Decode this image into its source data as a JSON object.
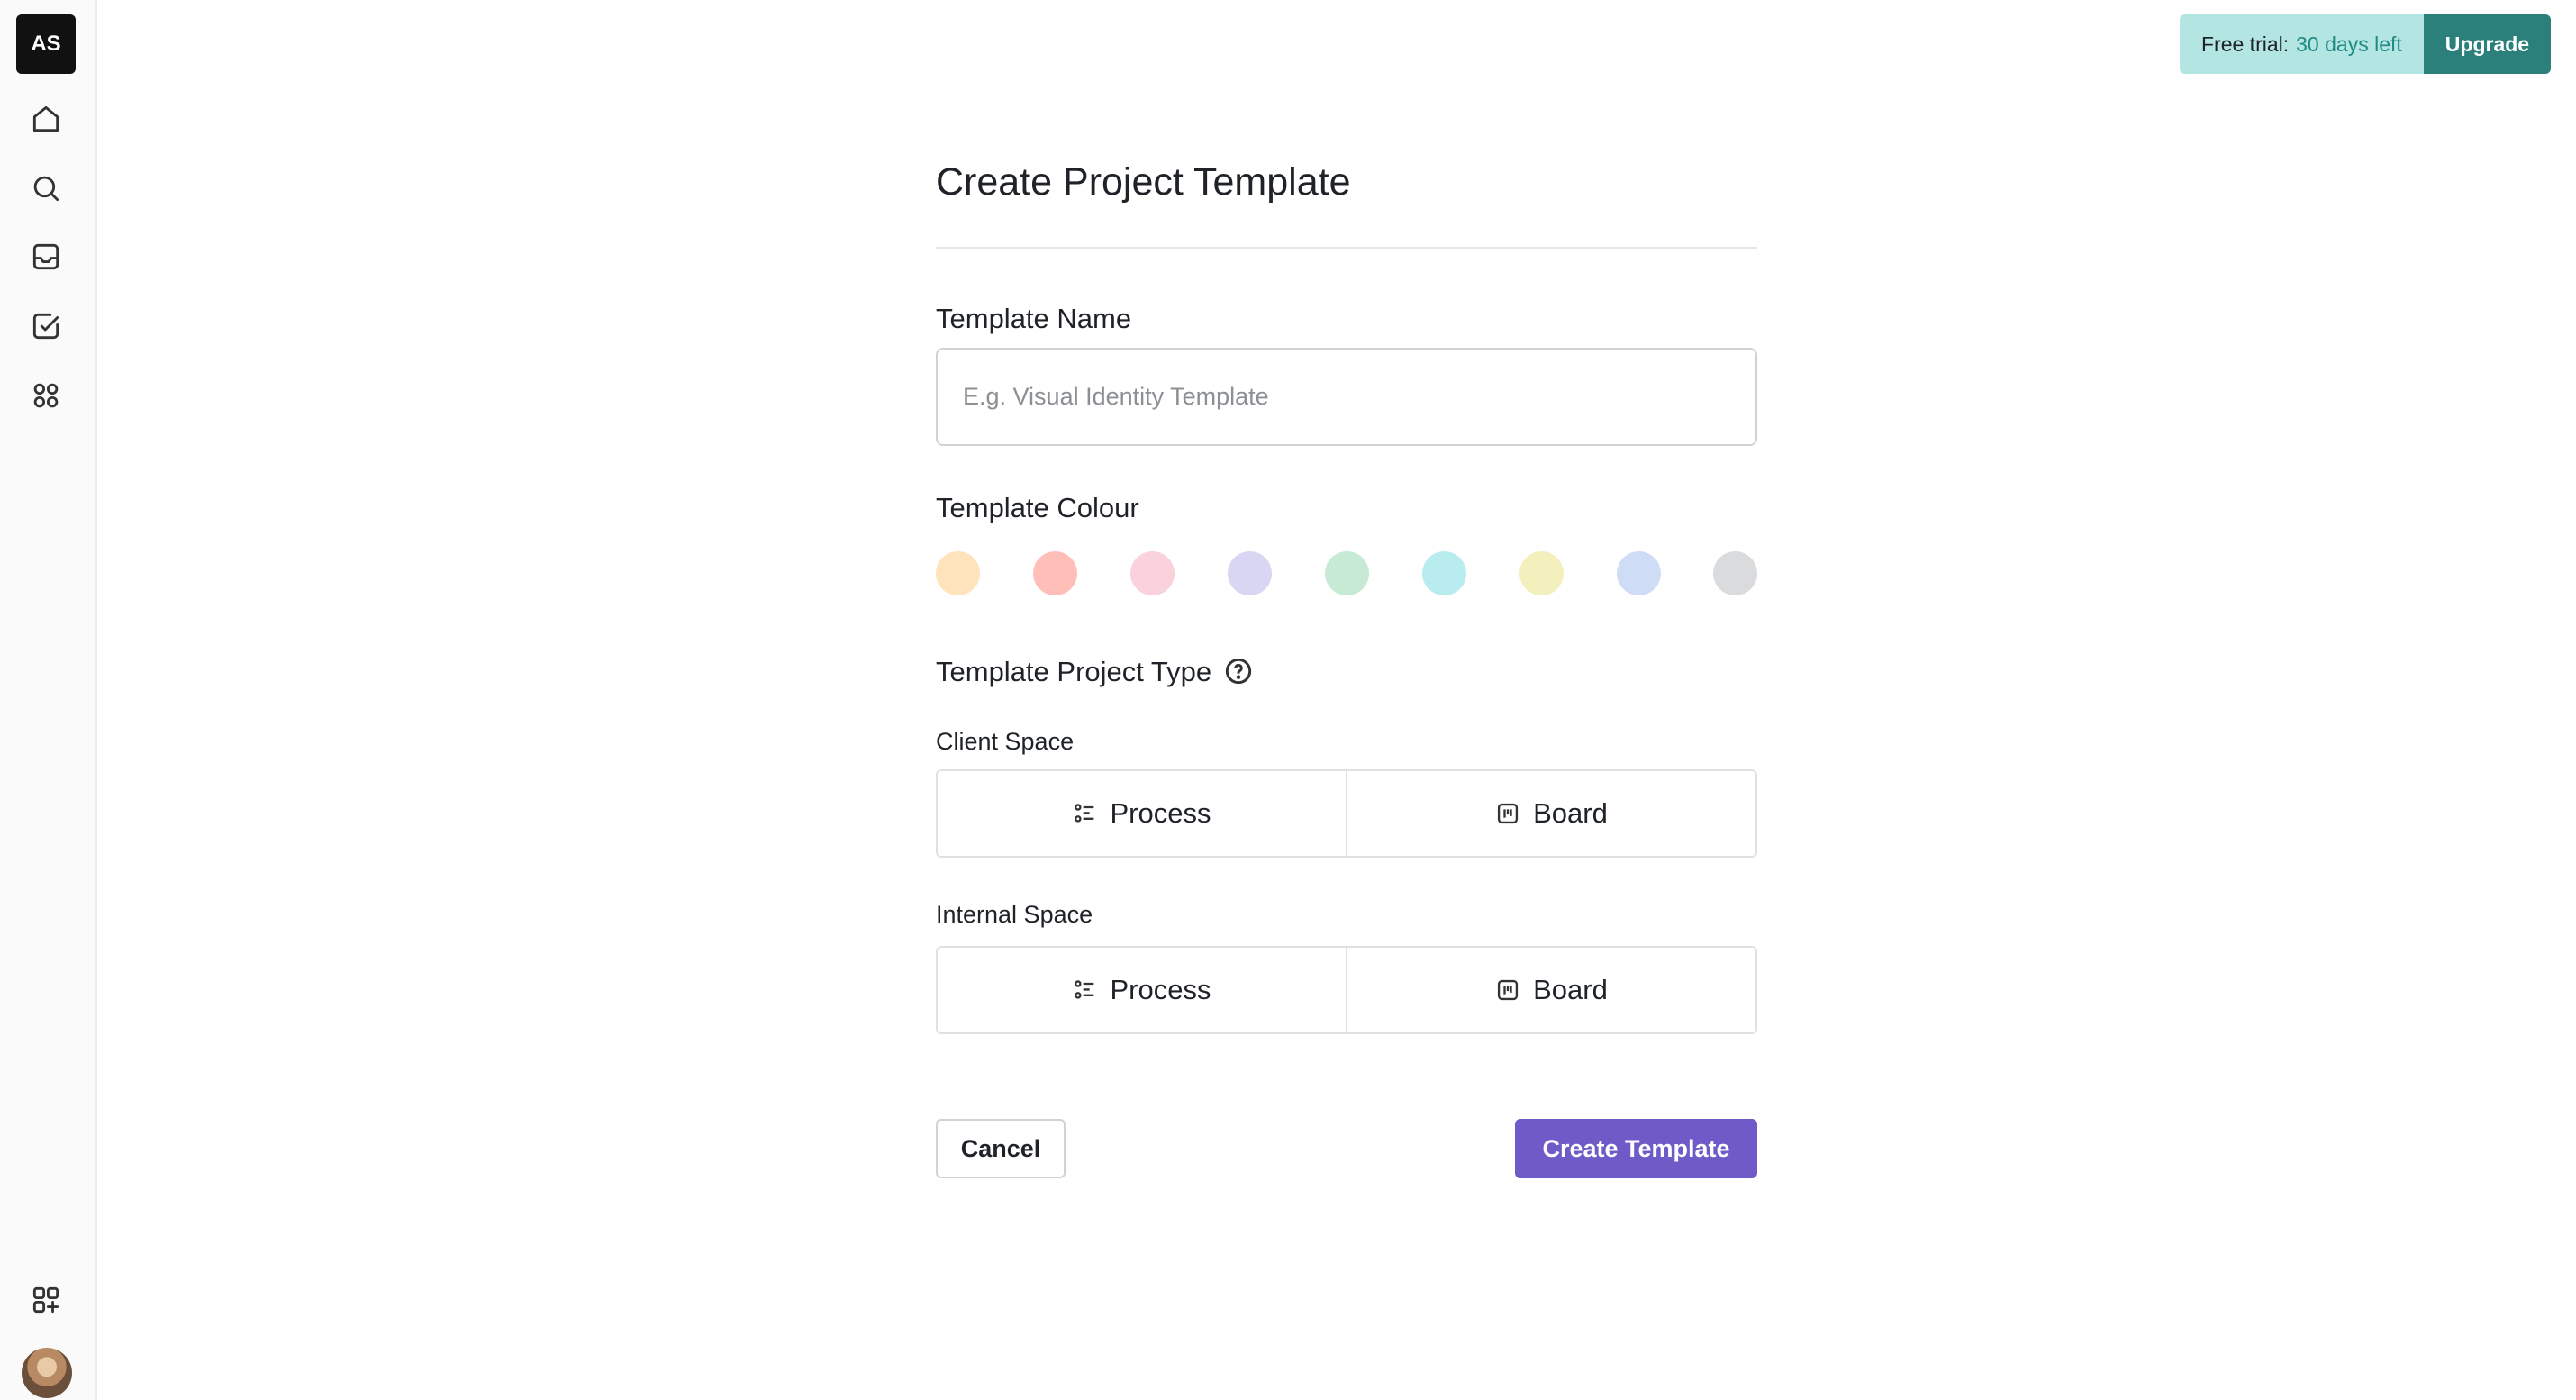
{
  "workspace": {
    "initials": "AS"
  },
  "sidebar": {
    "nav": [
      {
        "name": "home-icon"
      },
      {
        "name": "search-icon"
      },
      {
        "name": "inbox-icon"
      },
      {
        "name": "tasks-icon"
      },
      {
        "name": "apps-icon"
      }
    ],
    "bottom": [
      {
        "name": "add-app-icon"
      },
      {
        "name": "user-avatar"
      }
    ]
  },
  "trial": {
    "prefix": "Free trial:",
    "days": "30 days left",
    "upgrade_label": "Upgrade"
  },
  "form": {
    "title": "Create Project Template",
    "name_label": "Template Name",
    "name_placeholder": "E.g. Visual Identity Template",
    "name_value": "",
    "colour_label": "Template Colour",
    "colours": [
      "#ffe3bd",
      "#ffbfb8",
      "#f9d2dc",
      "#d8d6f3",
      "#c7ead5",
      "#b9ecef",
      "#f3f0bd",
      "#cfdcf6",
      "#dadbdd"
    ],
    "type_label": "Template Project Type",
    "client_space": {
      "label": "Client Space",
      "options": [
        "Process",
        "Board"
      ]
    },
    "internal_space": {
      "label": "Internal Space",
      "options": [
        "Process",
        "Board"
      ]
    },
    "cancel_label": "Cancel",
    "create_label": "Create Template"
  }
}
